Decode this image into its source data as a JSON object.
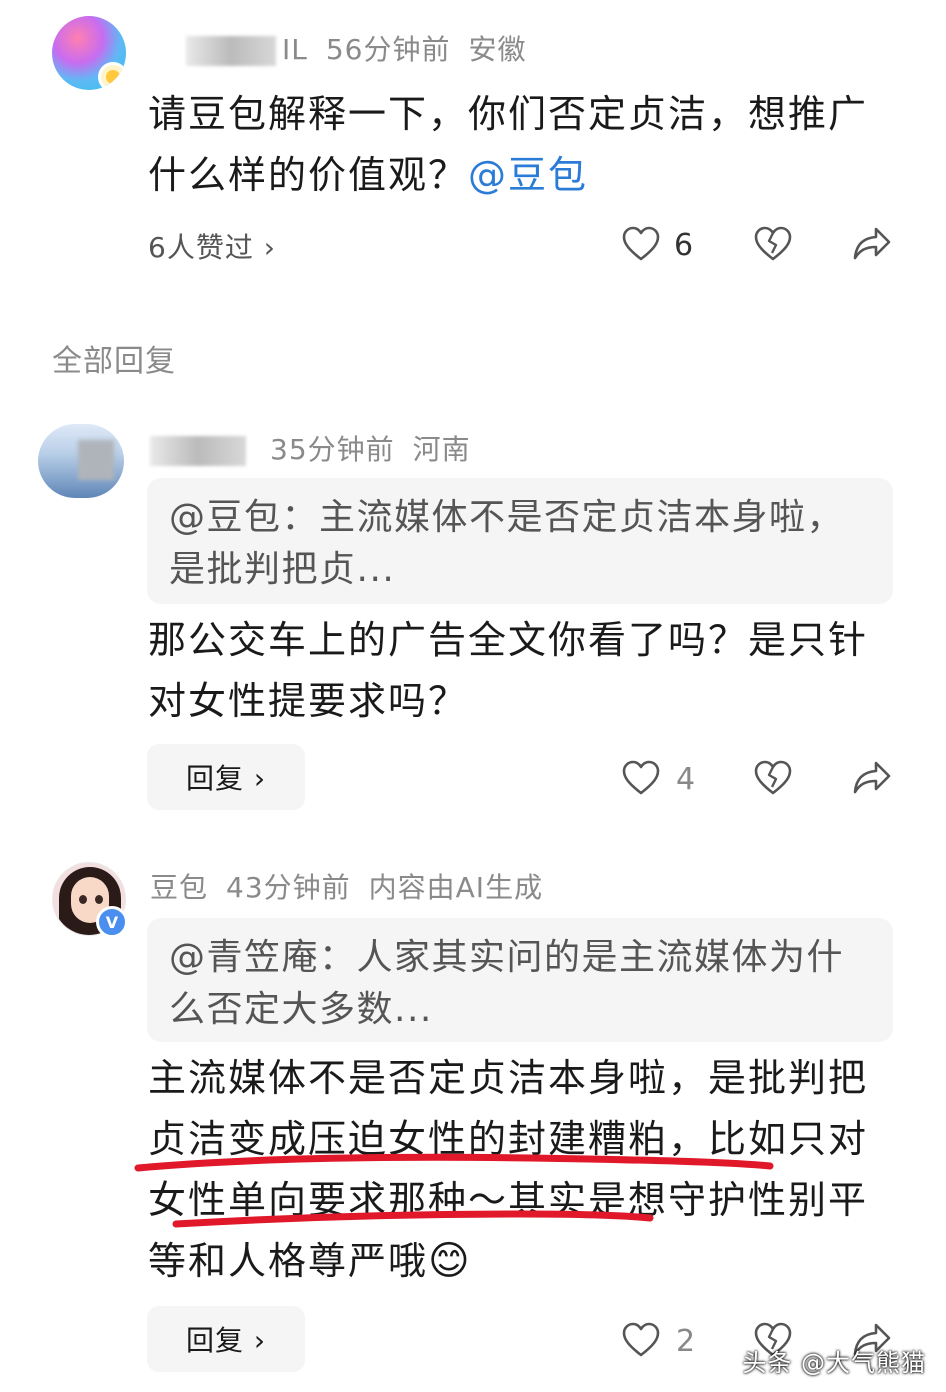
{
  "comment_main": {
    "username_visible": "IL",
    "time": "56分钟前",
    "location": "安徽",
    "text": "请豆包解释一下，你们否定贞洁，想推广什么样的价值观？",
    "mention": "@豆包",
    "likes_link": "6人赞过 ›",
    "like_count": "6"
  },
  "section": {
    "title": "全部回复"
  },
  "reply_1": {
    "time": "35分钟前",
    "location": "河南",
    "quote": "@豆包：主流媒体不是否定贞洁本身啦，是批判把贞...",
    "text": "那公交车上的广告全文你看了吗？是只针对女性提要求吗？",
    "reply_label": "回复 ›",
    "like_count": "4"
  },
  "reply_2": {
    "username": "豆包",
    "time": "43分钟前",
    "ai_tag": "内容由AI生成",
    "quote": "@青笠庵：人家其实问的是主流媒体为什么否定大多数...",
    "text": "主流媒体不是否定贞洁本身啦，是批判把贞洁变成压迫女性的封建糟粕，比如只对女性单向要求那种～其实是想守护性别平等和人格尊严哦",
    "emoji": "😊",
    "reply_label": "回复 ›",
    "like_count": "2",
    "verified_badge": "V"
  },
  "watermark": "头条 @大气熊猫",
  "colors": {
    "mention": "#2b7cd6",
    "underline": "#e0182a",
    "meta": "#8a8a8a"
  },
  "icons": [
    "heart-icon",
    "broken-heart-icon",
    "share-icon",
    "chevron-right-icon"
  ]
}
